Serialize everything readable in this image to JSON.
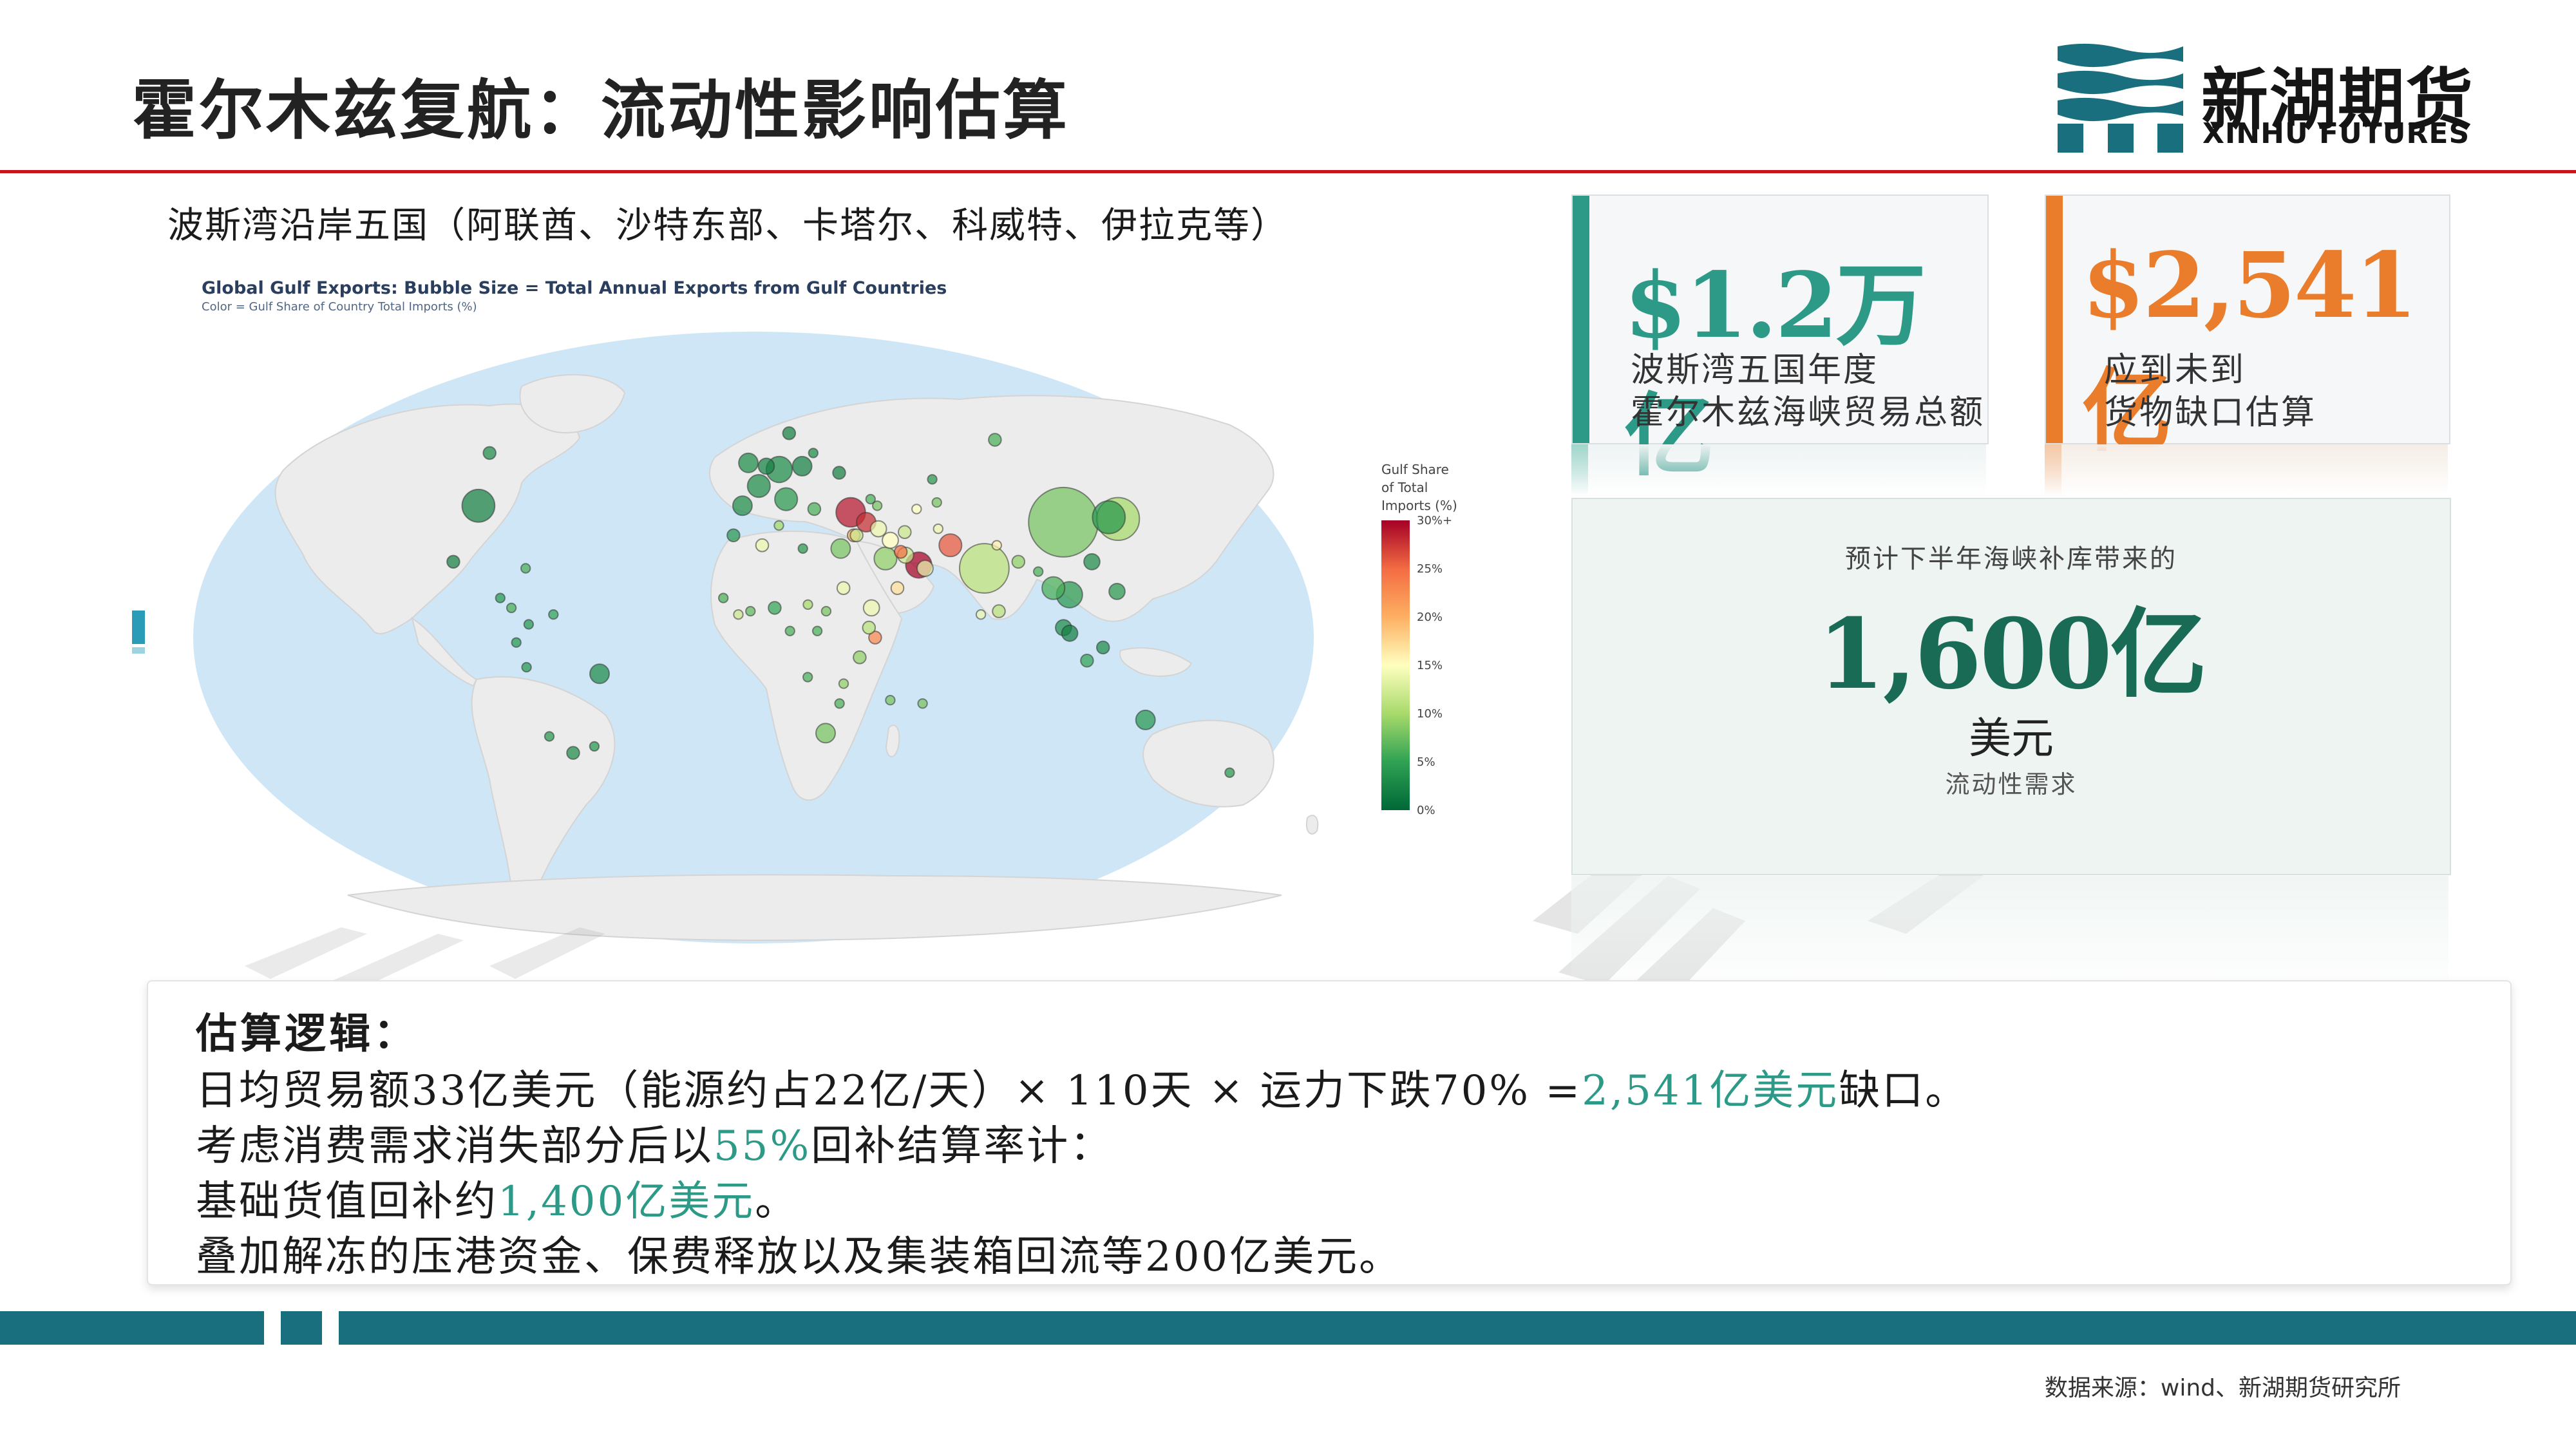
{
  "header": {
    "title": "霍尔木兹复航：流动性影响估算",
    "logo_cn": "新湖期货",
    "logo_en": "XINHU FUTURES"
  },
  "subtitle": "波斯湾沿岸五国（阿联酋、沙特东部、卡塔尔、科威特、伊拉克等）",
  "chart_data": {
    "type": "scatter",
    "title": "Global Gulf Exports: Bubble Size = Total Annual Exports from Gulf Countries",
    "subtitle": "Color = Gulf Share of Country Total Imports (%)",
    "colorbar": {
      "title_lines": [
        "Gulf Share",
        "of Total",
        "Imports (%)"
      ],
      "ticks": [
        "30%+",
        "25%",
        "20%",
        "15%",
        "10%",
        "5%",
        "0%"
      ],
      "range": [
        0,
        30
      ],
      "colors": [
        "#006837",
        "#31a354",
        "#a6d96a",
        "#ffffbf",
        "#fdae61",
        "#f46d43",
        "#a50026"
      ]
    },
    "points": [
      {
        "lon": 110,
        "lat": 35,
        "size": 20,
        "share": 8
      },
      {
        "lon": 130,
        "lat": 36,
        "size": 12,
        "share": 10
      },
      {
        "lon": 127,
        "lat": 36.5,
        "size": 9,
        "share": 4
      },
      {
        "lon": 78,
        "lat": 21,
        "size": 14,
        "share": 11
      },
      {
        "lon": 68,
        "lat": 28,
        "size": 6,
        "share": 26
      },
      {
        "lon": 56,
        "lat": 22,
        "size": 7,
        "share": 30
      },
      {
        "lon": 45,
        "lat": 24,
        "size": 6,
        "share": 9
      },
      {
        "lon": 47.5,
        "lat": 29.5,
        "size": 4,
        "share": 15
      },
      {
        "lon": 52,
        "lat": 25,
        "size": 4,
        "share": 12
      },
      {
        "lon": 50.5,
        "lat": 26,
        "size": 3,
        "share": 25
      },
      {
        "lon": 58,
        "lat": 21,
        "size": 4,
        "share": 14
      },
      {
        "lon": 35,
        "lat": 38,
        "size": 8,
        "share": 29
      },
      {
        "lon": 40,
        "lat": 35,
        "size": 5,
        "share": 28
      },
      {
        "lon": 44,
        "lat": 33,
        "size": 4,
        "share": 14
      },
      {
        "lon": 30,
        "lat": 27,
        "size": 5,
        "share": 8
      },
      {
        "lon": 35,
        "lat": 31,
        "size": 3,
        "share": 20
      },
      {
        "lon": 36,
        "lat": 31,
        "size": 3,
        "share": 12
      },
      {
        "lon": 48,
        "lat": 15,
        "size": 3,
        "share": 17
      },
      {
        "lon": 39,
        "lat": 9,
        "size": 4,
        "share": 14
      },
      {
        "lon": 40,
        "lat": 0,
        "size": 3,
        "share": 23
      },
      {
        "lon": 38,
        "lat": 3,
        "size": 3,
        "share": 11
      },
      {
        "lon": 33,
        "lat": 50,
        "size": 3,
        "share": 2
      },
      {
        "lon": 19,
        "lat": 52,
        "size": 5,
        "share": 2
      },
      {
        "lon": 10,
        "lat": 51,
        "size": 7,
        "share": 3
      },
      {
        "lon": 2,
        "lat": 46,
        "size": 6,
        "share": 3
      },
      {
        "lon": 12,
        "lat": 42,
        "size": 6,
        "share": 4
      },
      {
        "lon": -4,
        "lat": 40,
        "size": 5,
        "share": 3
      },
      {
        "lon": 5,
        "lat": 52,
        "size": 4,
        "share": 2
      },
      {
        "lon": -2,
        "lat": 53,
        "size": 5,
        "share": 3
      },
      {
        "lon": 15,
        "lat": 62,
        "size": 3,
        "share": 2
      },
      {
        "lon": 24,
        "lat": 56,
        "size": 2,
        "share": 3
      },
      {
        "lon": 22,
        "lat": 39,
        "size": 3,
        "share": 6
      },
      {
        "lon": 100,
        "lat": 60,
        "size": 3,
        "share": 6
      },
      {
        "lon": 105,
        "lat": 13,
        "size": 7,
        "share": 4
      },
      {
        "lon": 100,
        "lat": 15,
        "size": 6,
        "share": 6
      },
      {
        "lon": 115,
        "lat": 23,
        "size": 4,
        "share": 3
      },
      {
        "lon": 121,
        "lat": 14,
        "size": 4,
        "share": 4
      },
      {
        "lon": 102,
        "lat": 3,
        "size": 4,
        "share": 3
      },
      {
        "lon": 104,
        "lat": 1.3,
        "size": 4,
        "share": 2
      },
      {
        "lon": 115,
        "lat": -3,
        "size": 3,
        "share": 3
      },
      {
        "lon": 110,
        "lat": -7,
        "size": 3,
        "share": 5
      },
      {
        "lon": 134,
        "lat": -25,
        "size": 5,
        "share": 4
      },
      {
        "lon": 174,
        "lat": -41,
        "size": 2,
        "share": 4
      },
      {
        "lon": 25,
        "lat": -29,
        "size": 5,
        "share": 8
      },
      {
        "lon": 7,
        "lat": 9,
        "size": 3,
        "share": 5
      },
      {
        "lon": 3,
        "lat": 28,
        "size": 3,
        "share": 14
      },
      {
        "lon": -7,
        "lat": 31,
        "size": 3,
        "share": 4
      },
      {
        "lon": 9,
        "lat": 34,
        "size": 2,
        "share": 10
      },
      {
        "lon": 17,
        "lat": 27,
        "size": 2,
        "share": 4
      },
      {
        "lon": 30,
        "lat": 15,
        "size": 3,
        "share": 14
      },
      {
        "lon": 35,
        "lat": -6,
        "size": 3,
        "share": 9
      },
      {
        "lon": 29,
        "lat": -20,
        "size": 2,
        "share": 6
      },
      {
        "lon": 30,
        "lat": -14,
        "size": 2,
        "share": 9
      },
      {
        "lon": 18,
        "lat": -12,
        "size": 2,
        "share": 6
      },
      {
        "lon": 21,
        "lat": 2,
        "size": 2,
        "share": 6
      },
      {
        "lon": 12,
        "lat": 2,
        "size": 2,
        "share": 6
      },
      {
        "lon": -1,
        "lat": 8,
        "size": 2,
        "share": 7
      },
      {
        "lon": -10,
        "lat": 12,
        "size": 2,
        "share": 6
      },
      {
        "lon": -5,
        "lat": 7,
        "size": 2,
        "share": 12
      },
      {
        "lon": 24,
        "lat": 8,
        "size": 2,
        "share": 8
      },
      {
        "lon": 18,
        "lat": 10,
        "size": 2,
        "share": 10
      },
      {
        "lon": 46,
        "lat": -19,
        "size": 2,
        "share": 8
      },
      {
        "lon": 57,
        "lat": -20,
        "size": 2,
        "share": 8
      },
      {
        "lon": -100,
        "lat": 40,
        "size": 9,
        "share": 2
      },
      {
        "lon": -106,
        "lat": 56,
        "size": 3,
        "share": 3
      },
      {
        "lon": -102,
        "lat": 23,
        "size": 3,
        "share": 2
      },
      {
        "lon": -51,
        "lat": -11,
        "size": 5,
        "share": 3
      },
      {
        "lon": -64,
        "lat": -35,
        "size": 3,
        "share": 3
      },
      {
        "lon": -71,
        "lat": -30,
        "size": 2,
        "share": 4
      },
      {
        "lon": -75,
        "lat": -9,
        "size": 2,
        "share": 4
      },
      {
        "lon": -74,
        "lat": 4,
        "size": 2,
        "share": 4
      },
      {
        "lon": -66,
        "lat": 7,
        "size": 2,
        "share": 5
      },
      {
        "lon": -78,
        "lat": -1.5,
        "size": 2,
        "share": 4
      },
      {
        "lon": -56,
        "lat": -33,
        "size": 2,
        "share": 4
      },
      {
        "lon": -80,
        "lat": 9,
        "size": 2,
        "share": 6
      },
      {
        "lon": -84,
        "lat": 12,
        "size": 2,
        "share": 4
      },
      {
        "lon": -77,
        "lat": 21,
        "size": 2,
        "share": 6
      },
      {
        "lon": 75,
        "lat": 7,
        "size": 2,
        "share": 14
      },
      {
        "lon": 81,
        "lat": 8,
        "size": 3,
        "share": 11
      },
      {
        "lon": 90,
        "lat": 23,
        "size": 3,
        "share": 9
      },
      {
        "lon": 84,
        "lat": 28,
        "size": 2,
        "share": 16
      },
      {
        "lon": 96,
        "lat": 20,
        "size": 2,
        "share": 6
      },
      {
        "lon": 67,
        "lat": 41,
        "size": 2,
        "share": 8
      },
      {
        "lon": 65,
        "lat": 33,
        "size": 2,
        "share": 14
      },
      {
        "lon": 68,
        "lat": 48,
        "size": 2,
        "share": 4
      },
      {
        "lon": 45,
        "lat": 40,
        "size": 2,
        "share": 8
      },
      {
        "lon": 43,
        "lat": 42,
        "size": 2,
        "share": 6
      },
      {
        "lon": 53,
        "lat": 32,
        "size": 3,
        "share": 12
      },
      {
        "lon": 59,
        "lat": 39,
        "size": 2,
        "share": 15
      }
    ]
  },
  "cards": {
    "trade": {
      "value": "$1.2万亿",
      "label_lines": [
        "波斯湾五国年度",
        "霍尔木兹海峡贸易总额"
      ]
    },
    "shortfall": {
      "value": "$2,541亿",
      "label_lines": [
        "应到未到",
        "货物缺口估算"
      ]
    },
    "liquidity": {
      "top": "预计下半年海峡补库带来的",
      "value": "1,600亿",
      "unit": "美元",
      "note": "流动性需求"
    }
  },
  "colors": {
    "teal": "#2c9a87",
    "orange": "#ea7d2c",
    "dark_green": "#1a6b55",
    "red_rule": "#c8161d",
    "band": "#1a6f7e"
  },
  "logic": {
    "heading": "估算逻辑：",
    "line1": {
      "pre": "日均贸易额33亿美元（能源约占22亿/天）× 110天 × 运力下跌70% =",
      "hl": "2,541亿美元",
      "post": "缺口。"
    },
    "line2": {
      "pre": "考虑消费需求消失部分后以",
      "hl": "55%",
      "post": "回补结算率计："
    },
    "line3": {
      "pre": "基础货值回补约",
      "hl": "1,400亿美元",
      "post": "。"
    },
    "line4": "叠加解冻的压港资金、保费释放以及集装箱回流等200亿美元。"
  },
  "source": "数据来源：wind、新湖期货研究所"
}
